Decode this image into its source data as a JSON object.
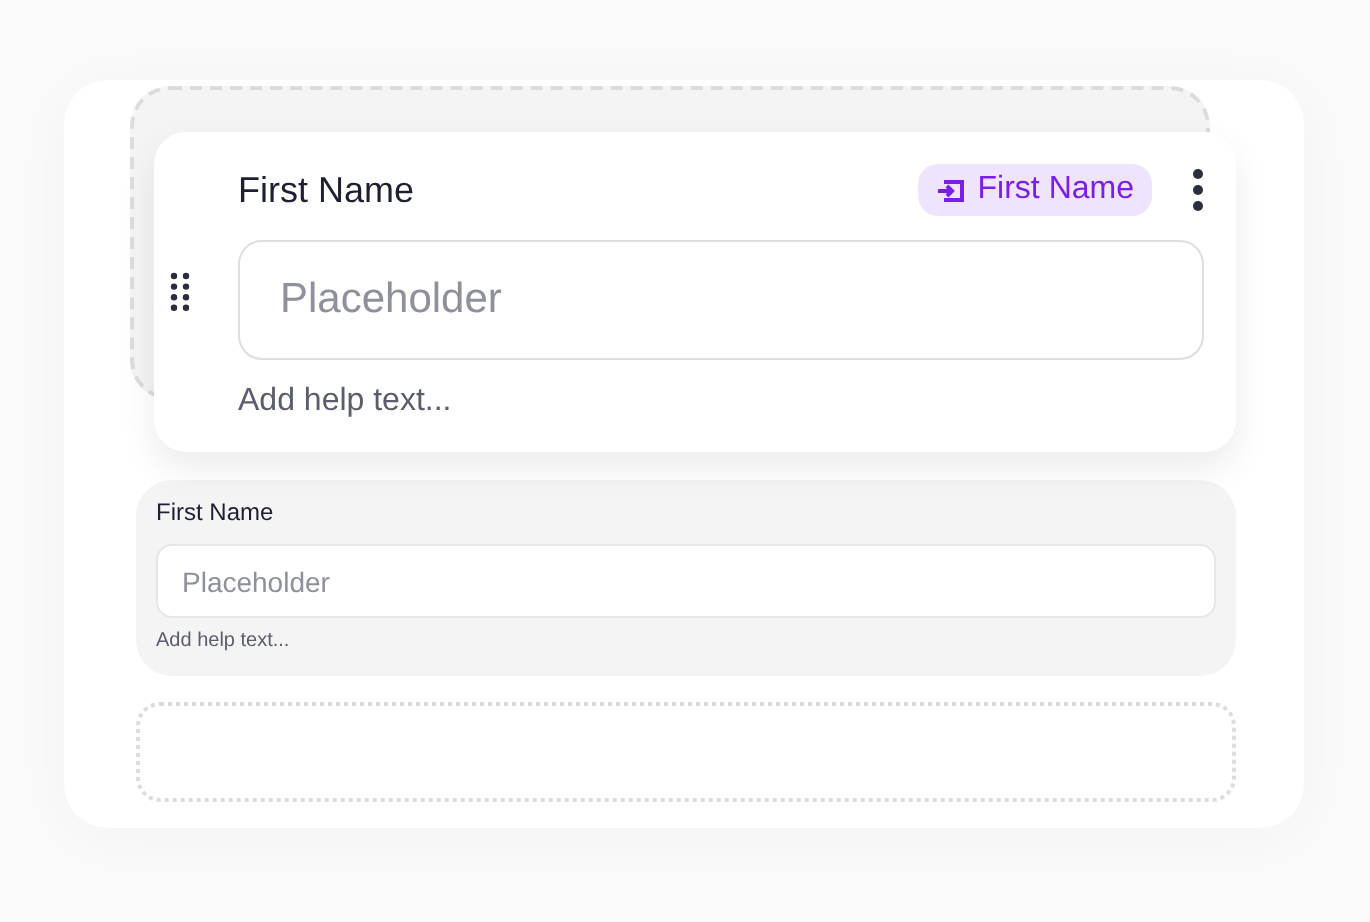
{
  "dragged_field": {
    "label": "First Name",
    "tag": "First Name",
    "placeholder": "Placeholder",
    "help_text": "Add help text..."
  },
  "fields": [
    {
      "label": "First Name",
      "placeholder": "Placeholder",
      "help_text": "Add help text..."
    }
  ]
}
